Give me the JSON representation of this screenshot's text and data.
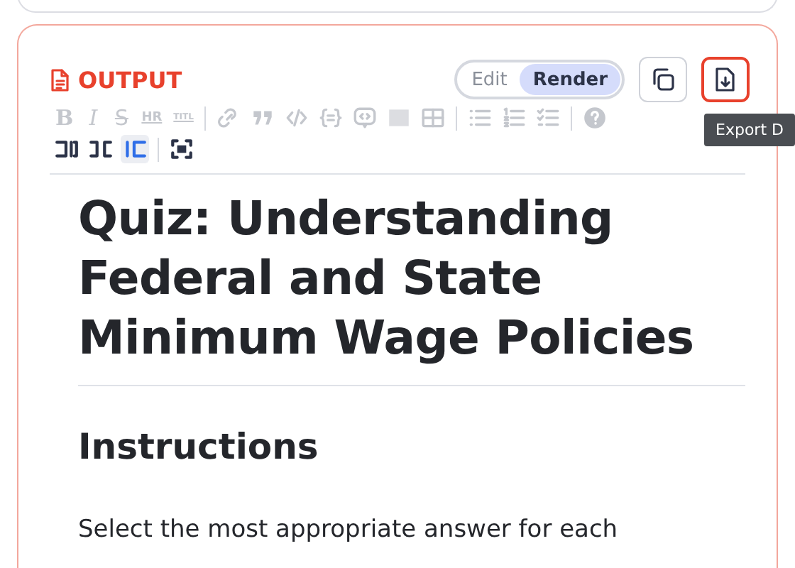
{
  "output_panel": {
    "title": "OUTPUT",
    "view_toggle": [
      {
        "label": "Edit",
        "selected": false
      },
      {
        "label": "Render",
        "selected": true
      }
    ],
    "export_button": {
      "highlighted": true
    },
    "tooltip": "Export D",
    "toolbar": [
      [
        {
          "kind": "bold",
          "label": "B",
          "disabled": true
        },
        {
          "kind": "italic",
          "label": "I",
          "disabled": true
        },
        {
          "kind": "strike",
          "label": "S",
          "disabled": true
        },
        {
          "kind": "hr",
          "label": "HR",
          "disabled": true
        },
        {
          "kind": "title",
          "label": "TITL",
          "disabled": true
        },
        {
          "kind": "separator"
        },
        {
          "kind": "link",
          "disabled": true
        },
        {
          "kind": "quote",
          "disabled": true
        },
        {
          "kind": "code",
          "disabled": true
        },
        {
          "kind": "braces",
          "disabled": true
        },
        {
          "kind": "embed",
          "disabled": true
        },
        {
          "kind": "image",
          "disabled": true
        },
        {
          "kind": "table",
          "disabled": true
        },
        {
          "kind": "separator"
        },
        {
          "kind": "ul",
          "disabled": true
        },
        {
          "kind": "ol",
          "disabled": true
        },
        {
          "kind": "tasks",
          "disabled": true
        },
        {
          "kind": "separator"
        },
        {
          "kind": "help",
          "disabled": true
        }
      ],
      [
        {
          "kind": "side-left",
          "selected": false
        },
        {
          "kind": "side-both",
          "selected": false
        },
        {
          "kind": "side-right",
          "selected": true
        },
        {
          "kind": "separator"
        },
        {
          "kind": "fullscreen",
          "selected": false
        }
      ]
    ],
    "document": [
      {
        "kind": "h1",
        "text": "Quiz: Understanding Federal and State Minimum Wage Policies"
      },
      {
        "kind": "h2",
        "text": "Instructions"
      },
      {
        "kind": "p",
        "text": "Select the most appropriate answer for each"
      }
    ]
  }
}
